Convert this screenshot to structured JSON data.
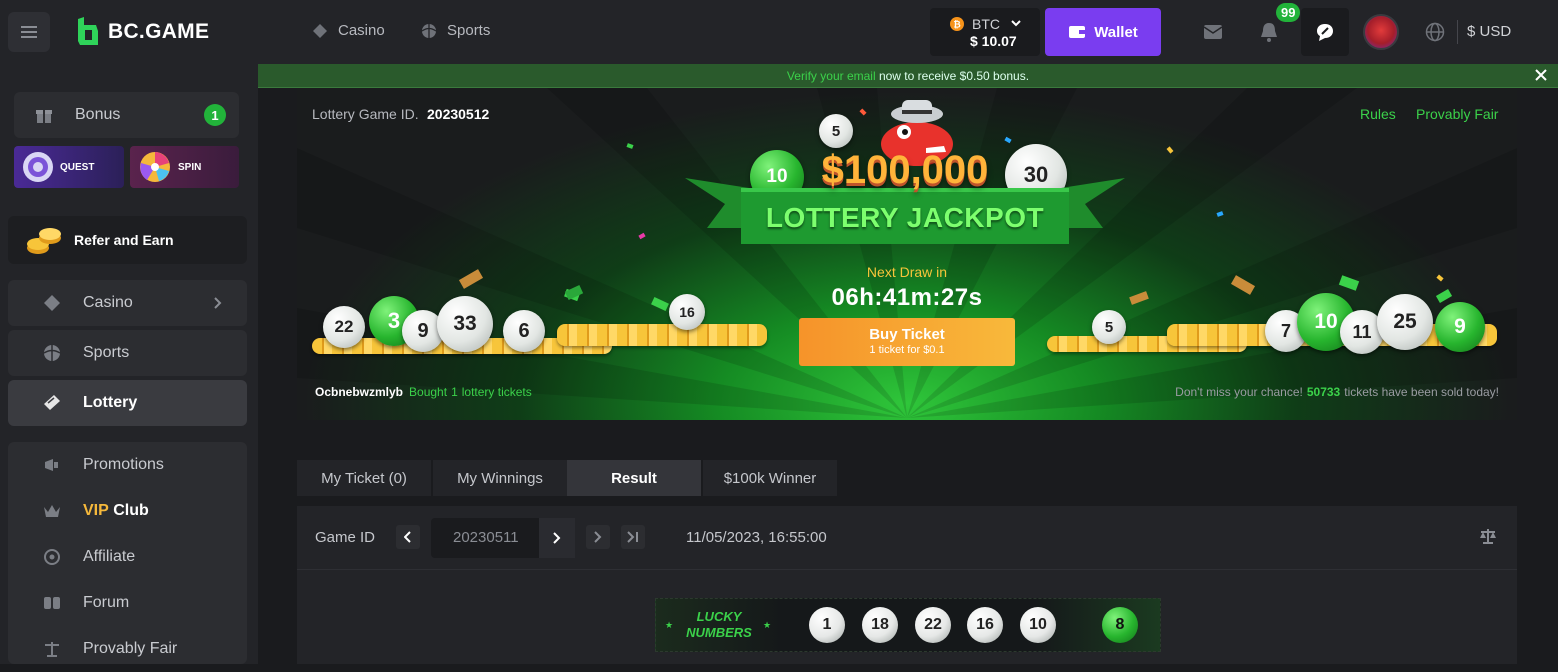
{
  "brand": {
    "name": "BC.GAME"
  },
  "topnav": {
    "casino": "Casino",
    "sports": "Sports"
  },
  "currency": {
    "code": "BTC",
    "balance": "$ 10.07"
  },
  "wallet": {
    "label": "Wallet"
  },
  "notifications": {
    "count": "99"
  },
  "locale": {
    "currency": "$ USD"
  },
  "verify_banner": {
    "link": "Verify your email",
    "text": " now to receive $0.50 bonus."
  },
  "sidebar": {
    "bonus": {
      "label": "Bonus",
      "count": "1"
    },
    "quest": "QUEST",
    "spin": "SPIN",
    "refer": "Refer and Earn",
    "items": [
      {
        "label": "Casino"
      },
      {
        "label": "Sports"
      },
      {
        "label": "Lottery"
      }
    ],
    "items2": [
      {
        "label": "Promotions"
      },
      {
        "label": "VIP",
        "label2": " Club"
      },
      {
        "label": "Affiliate"
      },
      {
        "label": "Forum"
      },
      {
        "label": "Provably Fair"
      }
    ]
  },
  "lottery": {
    "game_id_label": "Lottery Game ID.",
    "game_id": "20230512",
    "rules": "Rules",
    "provably_fair": "Provably Fair",
    "jackpot_amount": "$100,000",
    "jackpot_title": "LOTTERY JACKPOT",
    "next_draw_label": "Next Draw in",
    "countdown": "06h:41m:27s",
    "buy_label": "Buy Ticket",
    "buy_sub": "1 ticket for $0.1",
    "activity_user": "Ocbnebwzmlyb",
    "activity_text": "Bought",
    "activity_count": "1",
    "activity_tail": "lottery tickets",
    "sold_prefix": "Don't miss your chance!",
    "sold_count": "50733",
    "sold_suffix": "tickets have been sold today!",
    "deco_balls_left": [
      "22",
      "3",
      "9",
      "33",
      "6",
      "16"
    ],
    "deco_balls_right": [
      "5",
      "7",
      "10",
      "11",
      "25",
      "9"
    ],
    "deco_top": [
      "5",
      "10",
      "30"
    ]
  },
  "tabs": [
    {
      "label": "My Ticket (0)"
    },
    {
      "label": "My Winnings"
    },
    {
      "label": "Result"
    },
    {
      "label": "$100k Winner"
    }
  ],
  "results": {
    "game_id_label": "Game ID",
    "game_id_value": "20230511",
    "datetime": "11/05/2023, 16:55:00",
    "lucky_line1": "LUCKY",
    "lucky_line2": "NUMBERS",
    "numbers": [
      "1",
      "18",
      "22",
      "16",
      "10"
    ],
    "bonus_number": "8"
  },
  "colors": {
    "accent_green": "#22b33a",
    "wallet_purple": "#7a3df0",
    "buy_orange": "#f6a623",
    "vip_gold": "#f5b83b"
  }
}
